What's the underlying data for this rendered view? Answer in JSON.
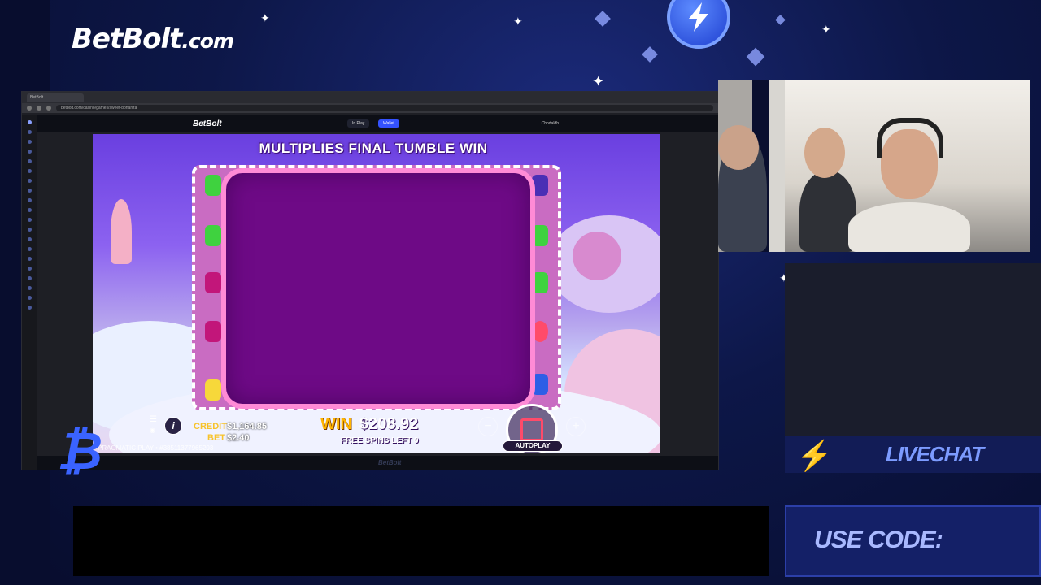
{
  "brand": {
    "logo_main": "BetBolt",
    "logo_domain": ".com"
  },
  "browser": {
    "tab_label": "BetBolt",
    "url": "betbolt.com/casino/games/sweet-bonanza",
    "site_logo": "BetBolt",
    "in_play_label": "In Play",
    "wallet_label": "Wallet",
    "user_label": "Chodaldb",
    "footer_logo": "BetBolt"
  },
  "game": {
    "banner": "MULTIPLIES FINAL TUMBLE WIN",
    "credit_label": "CREDIT",
    "credit_value": "$1,164.85",
    "bet_label": "BET",
    "bet_value": "$2.40",
    "win_label": "WIN",
    "win_value": "$208.92",
    "free_spins_text": "FREE SPINS LEFT 0",
    "provider_text": "PRAGMATIC PLAY • #38511377965203",
    "autoplay_label": "AUTOPLAY",
    "info_symbol": "i"
  },
  "overlay": {
    "livechat": "LIVECHAT",
    "use_code": "USE CODE:"
  },
  "colors": {
    "accent": "#3452ff",
    "win_gold": "#ffb400",
    "grid_purple": "#6e0a86",
    "frame_pink": "#ff8bd6"
  },
  "icons": [
    "lightning-bolt-icon",
    "bitcoin-icon",
    "search-icon",
    "menu-icon",
    "info-icon",
    "sound-icon"
  ]
}
